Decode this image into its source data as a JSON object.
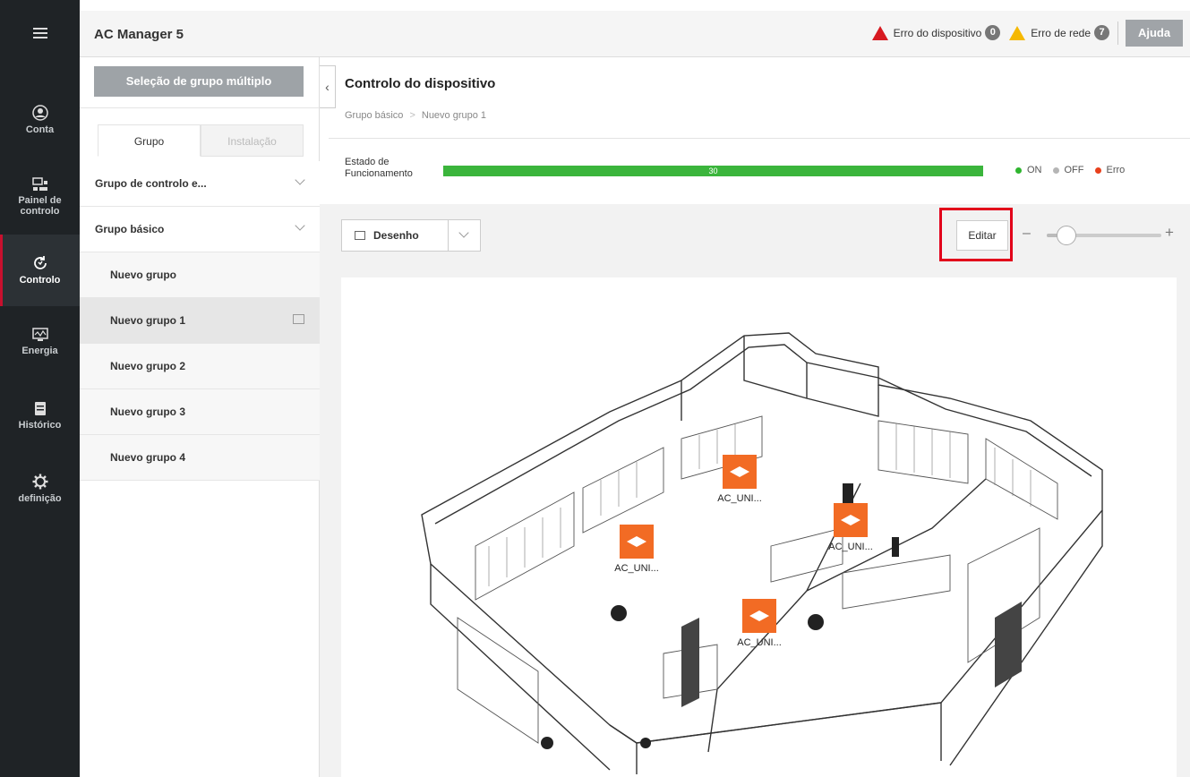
{
  "app": {
    "title": "AC Manager 5"
  },
  "header": {
    "device_error_label": "Erro do dispositivo",
    "device_error_count": "0",
    "network_error_label": "Erro de rede",
    "network_error_count": "7",
    "help_label": "Ajuda"
  },
  "rail": {
    "menu_icon": "hamburger-icon",
    "items": [
      {
        "label": "Conta",
        "icon": "user-icon"
      },
      {
        "label": "Painel de controlo",
        "icon": "dashboard-icon"
      },
      {
        "label": "Controlo",
        "icon": "control-icon"
      },
      {
        "label": "Energia",
        "icon": "energy-icon"
      },
      {
        "label": "Histórico",
        "icon": "history-icon"
      },
      {
        "label": "definição",
        "icon": "gear-icon"
      }
    ],
    "active": "Controlo"
  },
  "groups": {
    "multi_select_label": "Seleção de grupo múltiplo",
    "tabs": [
      {
        "label": "Grupo"
      },
      {
        "label": "Instalação"
      }
    ],
    "items": [
      {
        "label": "Grupo de controlo e..."
      },
      {
        "label": "Grupo básico"
      },
      {
        "label": "Nuevo grupo"
      },
      {
        "label": "Nuevo grupo 1"
      },
      {
        "label": "Nuevo grupo 2"
      },
      {
        "label": "Nuevo grupo 3"
      },
      {
        "label": "Nuevo grupo 4"
      }
    ],
    "selected": "Nuevo grupo 1"
  },
  "main": {
    "title": "Controlo do dispositivo",
    "breadcrumb": [
      "Grupo básico",
      "Nuevo grupo 1"
    ],
    "status_label_1": "Estado de",
    "status_label_2": "Funcionamento",
    "status_on_count": "30",
    "legend": [
      {
        "label": "ON",
        "color": "#2fb52f"
      },
      {
        "label": "OFF",
        "color": "#b5b5b5"
      },
      {
        "label": "Erro",
        "color": "#e8401c"
      }
    ],
    "view_label": "Desenho",
    "edit_label": "Editar",
    "zoom_level": 0.1
  },
  "floorplan": {
    "units": [
      {
        "label": "AC_UNI..."
      },
      {
        "label": "AC_UNI..."
      },
      {
        "label": "AC_UNI..."
      },
      {
        "label": "AC_UNI..."
      }
    ],
    "unit_color": "#f26b24"
  }
}
